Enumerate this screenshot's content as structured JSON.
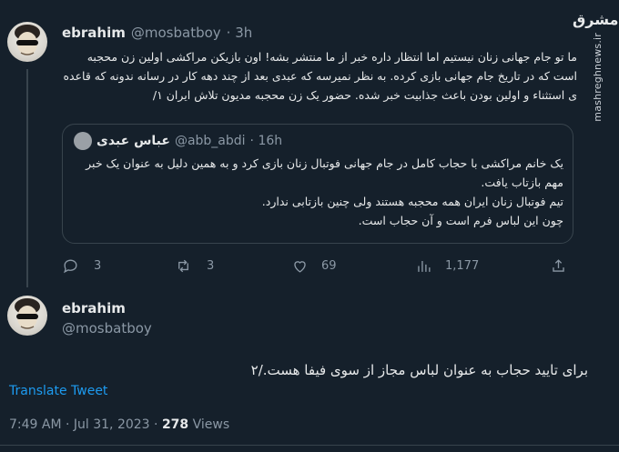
{
  "tweet1": {
    "name": "ebrahim",
    "handle": "@mosbatboy",
    "time": "· 3h",
    "text": "ما تو جام جهانی زنان نیستیم اما انتظار داره خبر از ما منتشر بشه! اون بازیکن مراکشی اولین زن محجبه است که در تاریخ جام جهانی بازی کرده. به نظر نمیرسه که عبدی بعد از چند دهه کار در رسانه ندونه که قاعده ی استثناء و اولین بودن باعث جذابیت خبر شده. حضور یک زن محجبه مدیون تلاش ایران ۱/",
    "quote": {
      "name": "عباس عبدی",
      "handle": "@abb_abdi",
      "time": "· 16h",
      "line1": "یک خانم مراکشی با حجاب کامل در جام جهانی فوتبال زنان بازی کرد و به همین دلیل به عنوان یک خبر مهم بازتاب یافت.",
      "line2": "تیم فوتبال زنان ایران همه محجبه هستند ولی چنین بازتابی ندارد.",
      "line3": "چون این لباس فرم است و آن حجاب است."
    },
    "actions": {
      "replies": "3",
      "retweets": "3",
      "likes": "69",
      "views": "1,177"
    }
  },
  "tweet2": {
    "name": "ebrahim",
    "handle": "@mosbatboy",
    "text": "برای تایید حجاب به عنوان لباس مجاز از سوی فیفا هست./۲",
    "translate_label": "Translate Tweet",
    "timestamp": "7:49 AM · Jul 31, 2023 · ",
    "views_count": "278",
    "views_label": " Views"
  },
  "watermark": {
    "logo": "مشرق",
    "site": "mashreghnews.ir"
  },
  "icons": [
    "avatar",
    "reply-icon",
    "retweet-icon",
    "like-icon",
    "views-icon",
    "share-icon"
  ]
}
